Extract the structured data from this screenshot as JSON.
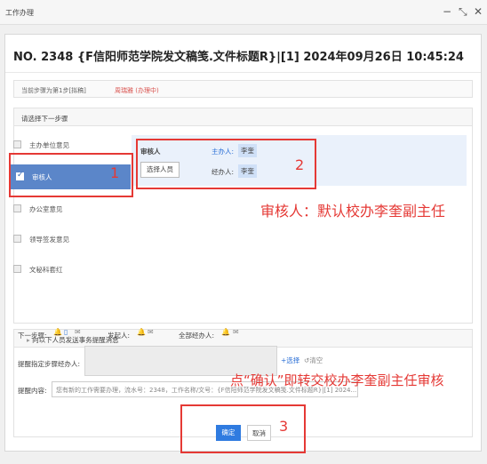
{
  "window": {
    "title": "工作办理"
  },
  "dialog": {
    "heading": "NO. 2348 {F信阳师范学院发文稿笺.文件标题R}|[1] 2024年09月26日 10:45:24",
    "current_step_label": "当前步骤为第1步[拟稿]",
    "current_step_user": "周瑞雅 (办理中)"
  },
  "next_step": {
    "header": "请选择下一步骤",
    "options": [
      {
        "label": "主办单位意见",
        "selected": false
      },
      {
        "label": "审核人",
        "selected": true
      },
      {
        "label": "办公室意见",
        "selected": false
      },
      {
        "label": "领导签发意见",
        "selected": false
      },
      {
        "label": "文秘科套红",
        "selected": false
      }
    ],
    "detail": {
      "step_name": "审核人",
      "select_button": "选择人员",
      "host_label": "主办人:",
      "host_value": "李奎",
      "handler_label": "经办人:",
      "handler_value": "李奎"
    }
  },
  "notify": {
    "header": "向以下人员发送事务提醒消息",
    "next_step_label": "下一步骤:",
    "initiator_label": "发起人:",
    "all_handlers_label": "全部经办人:",
    "specify_label": "提醒指定步骤经办人:",
    "select_link": "选择",
    "clear_link": "清空",
    "content_label": "提醒内容:",
    "content_value": "您有新的工作需要办理，流水号：2348，工作名称/文号：{F信阳师范学院发文稿笺.文件标题R}|[1] 2024..."
  },
  "buttons": {
    "confirm": "确定",
    "cancel": "取消"
  },
  "annotations": {
    "n1": "1",
    "n2": "2",
    "n3": "3",
    "note1": "审核人：默认校办李奎副主任",
    "note2": "点“确认”即转交校办李奎副主任审核"
  }
}
